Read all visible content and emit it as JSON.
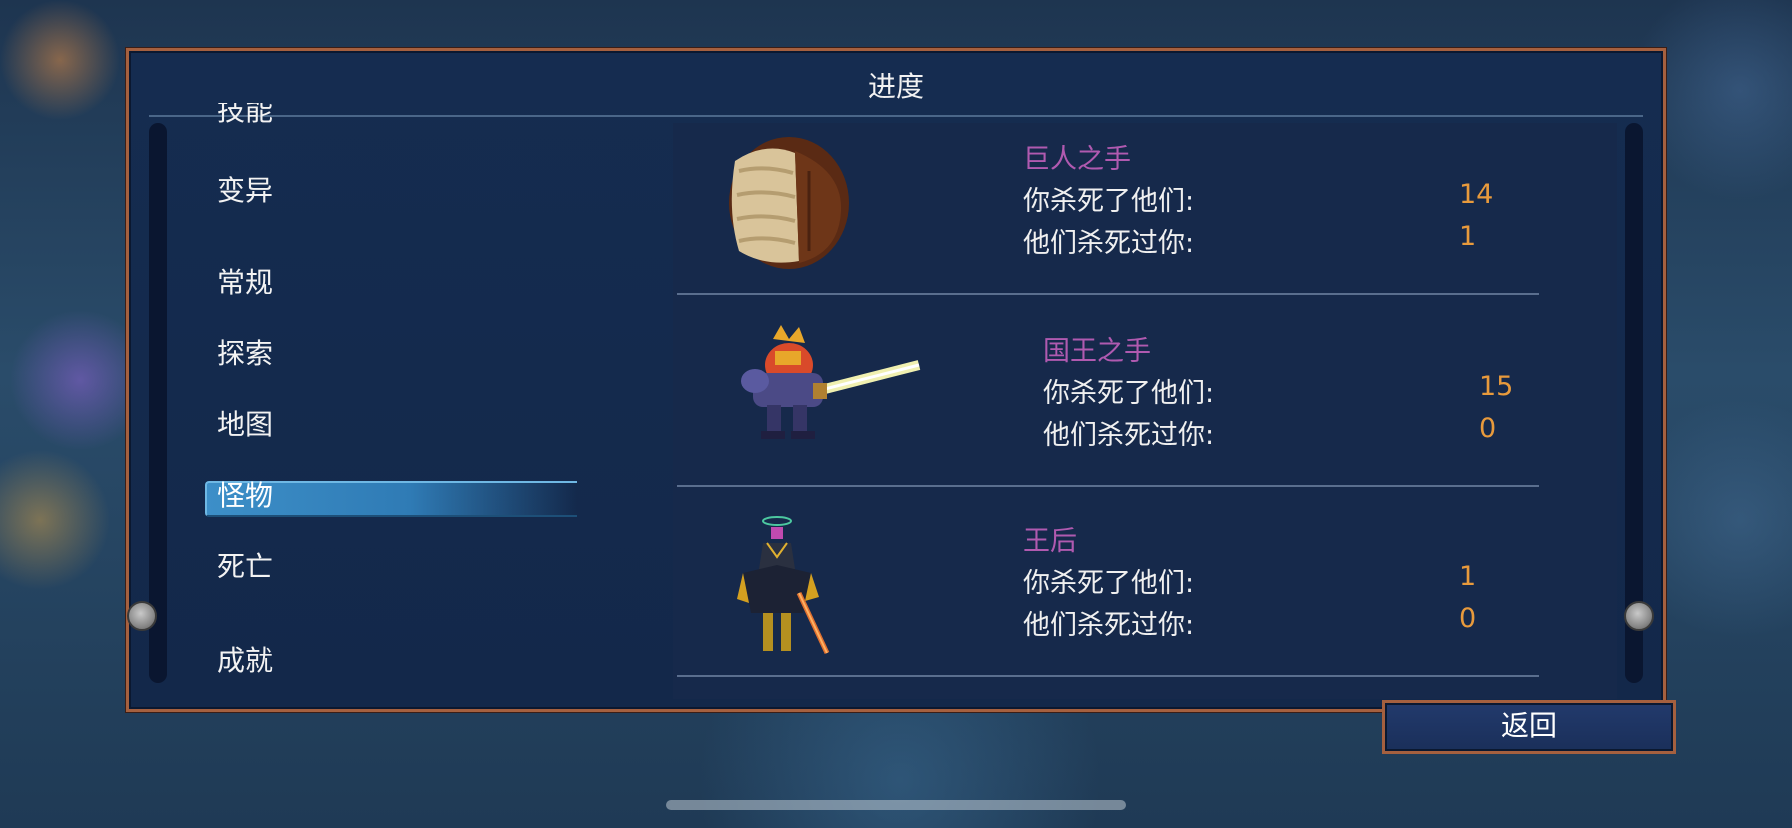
{
  "panel": {
    "title": "进度"
  },
  "menu": {
    "items": [
      {
        "label": "技能"
      },
      {
        "label": "变异"
      },
      {
        "label": "常规"
      },
      {
        "label": "探索"
      },
      {
        "label": "地图"
      },
      {
        "label": "怪物",
        "selected": true
      },
      {
        "label": "死亡"
      },
      {
        "label": "成就"
      }
    ]
  },
  "monsters": [
    {
      "name": "巨人之手",
      "kills_label": "你杀死了他们:",
      "kills": "14",
      "deaths_label": "他们杀死过你:",
      "deaths": "1",
      "icon": "giant-fist-icon"
    },
    {
      "name": "国王之手",
      "kills_label": "你杀死了他们:",
      "kills": "15",
      "deaths_label": "他们杀死过你:",
      "deaths": "0",
      "icon": "hand-of-the-king-icon"
    },
    {
      "name": "王后",
      "kills_label": "你杀死了他们:",
      "kills": "1",
      "deaths_label": "他们杀死过你:",
      "deaths": "0",
      "icon": "queen-icon"
    }
  ],
  "back_button": {
    "label": "返回"
  },
  "colors": {
    "panel_bg": "#152c50",
    "panel_border": "#a5603f",
    "selected_bar": "#3d8fc8",
    "monster_name": "#b05ab0",
    "stat_value": "#e89a3c"
  }
}
